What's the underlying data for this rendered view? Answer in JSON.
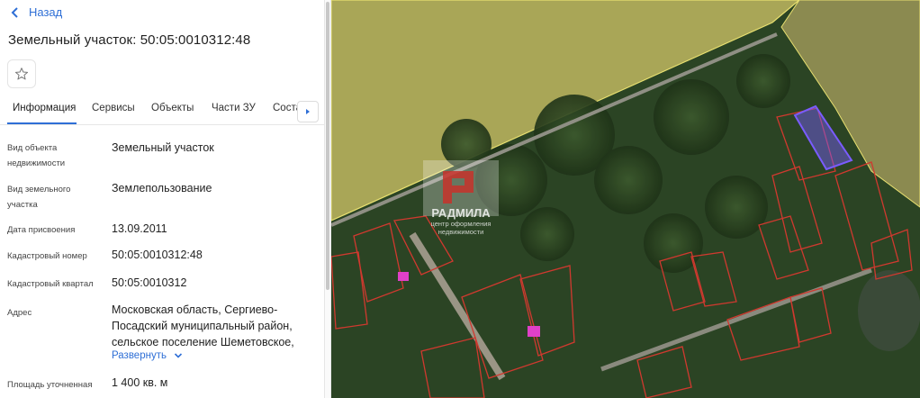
{
  "nav": {
    "back_label": "Назад"
  },
  "parcel": {
    "title": "Земельный участок: 50:05:0010312:48"
  },
  "tabs": [
    {
      "label": "Информация"
    },
    {
      "label": "Сервисы"
    },
    {
      "label": "Объекты"
    },
    {
      "label": "Части ЗУ"
    },
    {
      "label": "Соста"
    }
  ],
  "info": {
    "rows": [
      {
        "label_1": "Вид объекта",
        "label_2": "недвижимости",
        "value": "Земельный участок"
      },
      {
        "label_1": "Вид земельного",
        "label_2": "участка",
        "value": "Землепользование"
      },
      {
        "label_1": "Дата присвоения",
        "value": "13.09.2011"
      },
      {
        "label_1": "Кадастровый номер",
        "value": "50:05:0010312:48"
      },
      {
        "label_1": "Кадастровый квартал",
        "value": "50:05:0010312"
      },
      {
        "label_1": "Адрес",
        "value_1": "Московская область, Сергиево-",
        "value_2": "Посадский муниципальный район,",
        "value_3": "сельское поселение Шеметовское,"
      },
      {
        "label_1": "Площадь уточненная",
        "value": "1 400 кв. м"
      }
    ],
    "expand_label": "Развернуть"
  },
  "watermark": {
    "name": "РАДМИЛА",
    "line_1": "центр оформления",
    "line_2": "недвижимости"
  },
  "icons": {
    "back": "chevron-left-icon",
    "favorite": "star-icon",
    "tabs_next": "triangle-right-icon",
    "expand": "chevron-down-icon"
  },
  "colors": {
    "accent": "#2f6fd6",
    "parcel_outline": "#d0392f",
    "zone_fill": "#d9d96a",
    "selected_parcel": "#7a5cff",
    "highlight_parcel": "#e040c8"
  }
}
